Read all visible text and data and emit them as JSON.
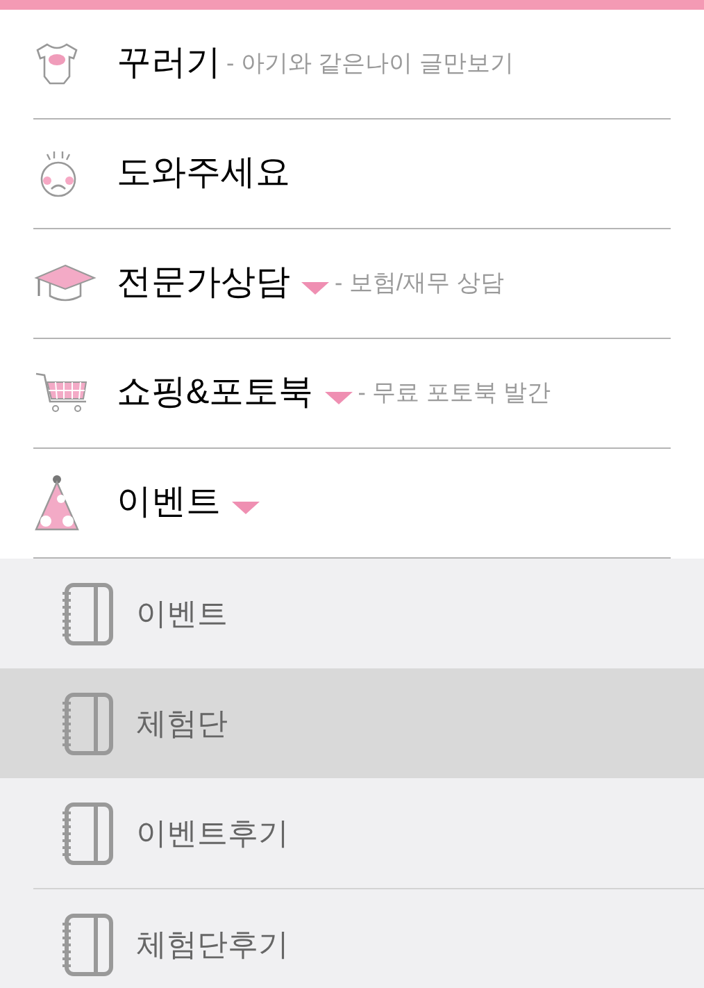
{
  "menu": [
    {
      "kind": "shirt",
      "label": "꾸러기",
      "dropdown": false,
      "subtitle": "- 아기와 같은나이 글만보기"
    },
    {
      "kind": "baby",
      "label": "도와주세요",
      "dropdown": false
    },
    {
      "kind": "cap",
      "label": "전문가상담",
      "dropdown": true,
      "subtitle": "- 보험/재무 상담"
    },
    {
      "kind": "cart",
      "label": "쇼핑&포토북",
      "dropdown": true,
      "subtitle": "- 무료 포토북 발간"
    },
    {
      "kind": "hat",
      "label": "이벤트",
      "dropdown": true,
      "children": [
        {
          "label": "이벤트",
          "selected": false,
          "divider_above": false
        },
        {
          "label": "체험단",
          "selected": true,
          "divider_above": false
        },
        {
          "label": "이벤트후기",
          "selected": false,
          "divider_above": false
        },
        {
          "label": "체험단후기",
          "selected": false,
          "divider_above": true
        }
      ]
    }
  ]
}
